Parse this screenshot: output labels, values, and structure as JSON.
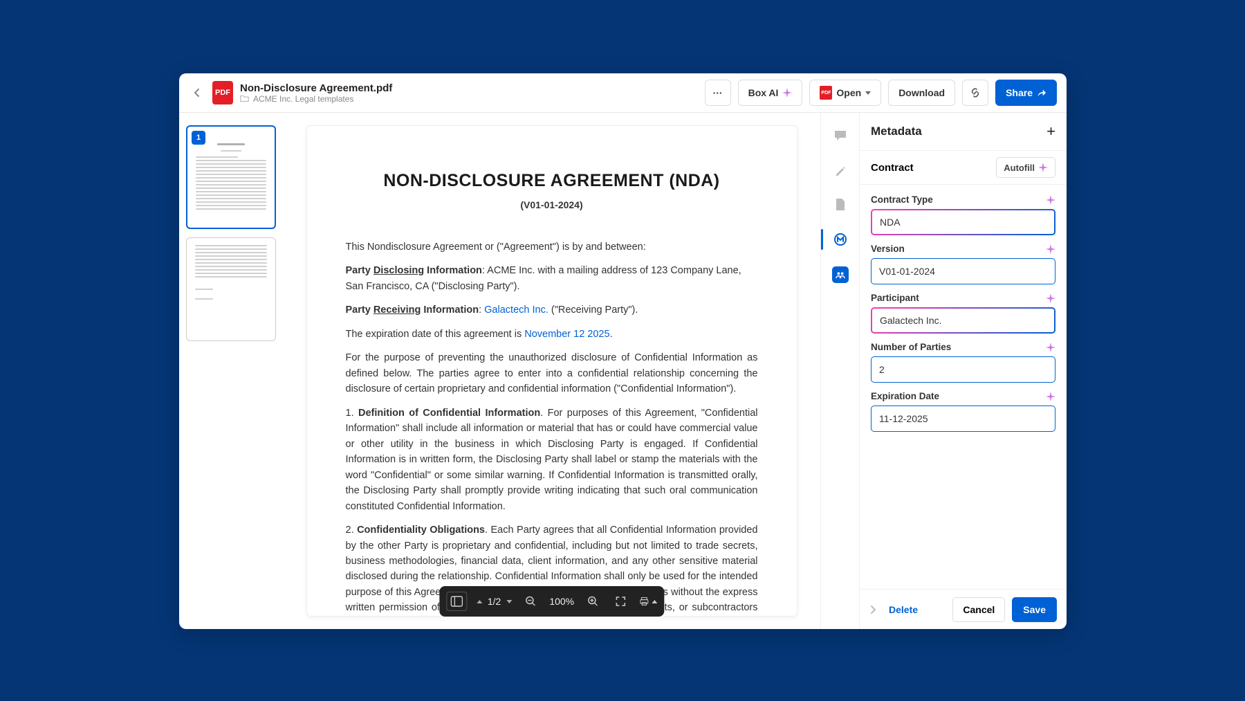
{
  "header": {
    "file_name": "Non-Disclosure Agreement.pdf",
    "breadcrumb": "ACME Inc. Legal templates",
    "box_ai_label": "Box AI",
    "open_label": "Open",
    "download_label": "Download",
    "share_label": "Share",
    "more_label": "···",
    "file_badge": "PDF"
  },
  "thumbnails": {
    "page1_num": "1"
  },
  "document": {
    "title": "NON-DISCLOSURE AGREEMENT (NDA)",
    "subtitle": "(V01-01-2024)",
    "intro": "This Nondisclosure Agreement or (\"Agreement\") is by and between:",
    "party_disclosing_prefix": "Party ",
    "party_disclosing_word": "Disclosing",
    "party_disclosing_label": " Information",
    "party_disclosing_value": ": ACME Inc. with a mailing address of 123 Company Lane, San Francisco, CA (\"Disclosing Party\").",
    "party_receiving_prefix": "Party ",
    "party_receiving_word": "Receiving",
    "party_receiving_label": " Information",
    "party_receiving_value1": ": ",
    "party_receiving_link": "Galactech Inc.",
    "party_receiving_value2": " (\"Receiving Party\").",
    "expiration_prefix": "The expiration date of this agreement is ",
    "expiration_link": "November 12 2025",
    "expiration_suffix": ".",
    "purpose": "For the purpose of preventing the unauthorized disclosure of Confidential Information as defined below. The parties agree to enter into a confidential relationship concerning the disclosure of certain proprietary and confidential information (\"Confidential Information\").",
    "section1_num": "1. ",
    "section1_title": "Definition of Confidential Information",
    "section1_body": ". For purposes of this Agreement, \"Confidential Information\" shall include all information or material that has or could have commercial value or other utility in the business in which Disclosing Party is engaged. If Confidential Information is in written form, the Disclosing Party shall label or stamp the materials with the word \"Confidential\" or some similar warning. If Confidential Information is transmitted orally, the Disclosing Party shall promptly provide writing indicating that such oral communication constituted Confidential Information.",
    "section2_num": "2. ",
    "section2_title": "Confidentiality Obligations",
    "section2_body": ". Each Party agrees that all Confidential Information provided by the other Party is proprietary and confidential, including but not limited to trade secrets, business methodologies, financial data, client information, and any other sensitive material disclosed during the relationship. Confidential Information shall only be used for the intended purpose of this Agreement and shall not be disclosed to any third parties without the express written permission of the Disclosing Party, except to employees, agents, or subcontractors who have a legitimate need to know such information and are under comparable confidentiality obligations. Each Party agrees to implement safeguards and precautions to ensure protection of the Confidential Information consistent with industry standards and as required by the Personal Information Protection and Electronic"
  },
  "viewer_toolbar": {
    "page_indicator": "1/2",
    "zoom_level": "100%"
  },
  "metadata": {
    "title": "Metadata",
    "section": "Contract",
    "autofill_label": "Autofill",
    "fields": {
      "contract_type": {
        "label": "Contract Type",
        "value": "NDA"
      },
      "version": {
        "label": "Version",
        "value": "V01-01-2024"
      },
      "participant": {
        "label": "Participant",
        "value": "Galactech Inc."
      },
      "num_parties": {
        "label": "Number of Parties",
        "value": "2"
      },
      "expiration": {
        "label": "Expiration Date",
        "value": "11-12-2025"
      }
    },
    "footer": {
      "delete": "Delete",
      "cancel": "Cancel",
      "save": "Save"
    }
  }
}
